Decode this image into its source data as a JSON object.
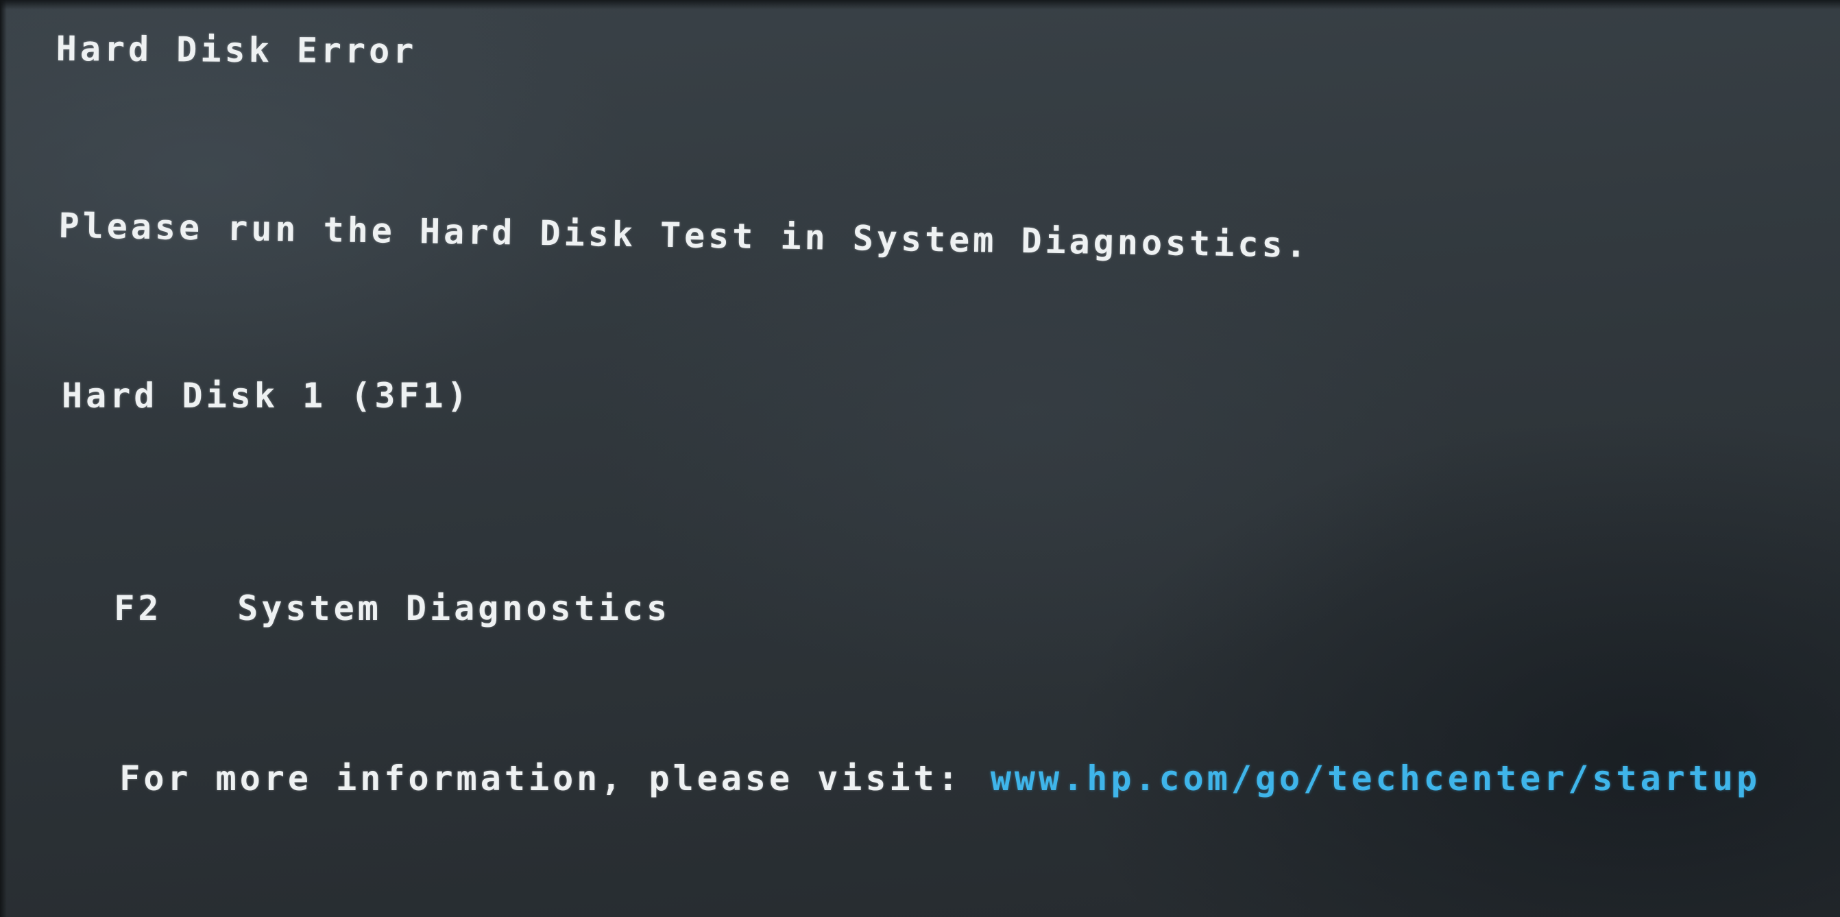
{
  "error": {
    "title": "Hard Disk Error",
    "instruction": "Please run the Hard Disk Test in System Diagnostics.",
    "device": "Hard Disk 1 (3F1)"
  },
  "option": {
    "key": "F2",
    "label": "System Diagnostics"
  },
  "info": {
    "text": "For more information, please visit:",
    "url": "www.hp.com/go/techcenter/startup"
  },
  "colors": {
    "background": "#30373c",
    "text": "#eef1f2",
    "link": "#3fb5ea"
  }
}
